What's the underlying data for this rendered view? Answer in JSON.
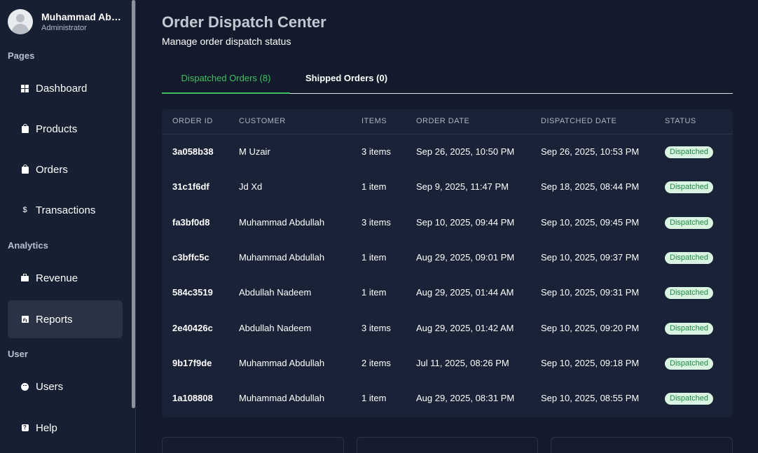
{
  "profile": {
    "name": "Muhammad Abdullah",
    "role": "Administrator"
  },
  "sidebar": {
    "sections": [
      "Pages",
      "Analytics",
      "User"
    ],
    "items": [
      {
        "label": "Dashboard",
        "icon": "dashboard-icon"
      },
      {
        "label": "Products",
        "icon": "shopping-bag-icon"
      },
      {
        "label": "Orders",
        "icon": "shopping-bag-icon"
      },
      {
        "label": "Transactions",
        "icon": "dollar-icon"
      },
      {
        "label": "Revenue",
        "icon": "briefcase-icon"
      },
      {
        "label": "Reports",
        "icon": "bar-chart-icon",
        "active": true
      },
      {
        "label": "Users",
        "icon": "face-icon"
      },
      {
        "label": "Help",
        "icon": "help-icon"
      }
    ]
  },
  "page": {
    "title": "Order Dispatch Center",
    "subtitle": "Manage order dispatch status"
  },
  "tabs": [
    {
      "label": "Dispatched Orders (8)",
      "active": true
    },
    {
      "label": "Shipped Orders (0)",
      "active": false
    }
  ],
  "table": {
    "columns": [
      "ORDER ID",
      "CUSTOMER",
      "ITEMS",
      "ORDER DATE",
      "DISPATCHED DATE",
      "STATUS"
    ],
    "rows": [
      [
        "3a058b38",
        "M Uzair",
        "3 items",
        "Sep 26, 2025, 10:50 PM",
        "Sep 26, 2025, 10:53 PM",
        "Dispatched"
      ],
      [
        "31c1f6df",
        "Jd Xd",
        "1 item",
        "Sep 9, 2025, 11:47 PM",
        "Sep 18, 2025, 08:44 PM",
        "Dispatched"
      ],
      [
        "fa3bf0d8",
        "Muhammad Abdullah",
        "3 items",
        "Sep 10, 2025, 09:44 PM",
        "Sep 10, 2025, 09:45 PM",
        "Dispatched"
      ],
      [
        "c3bffc5c",
        "Muhammad Abdullah",
        "1 item",
        "Aug 29, 2025, 09:01 PM",
        "Sep 10, 2025, 09:37 PM",
        "Dispatched"
      ],
      [
        "584c3519",
        "Abdullah Nadeem",
        "1 item",
        "Aug 29, 2025, 01:44 AM",
        "Sep 10, 2025, 09:31 PM",
        "Dispatched"
      ],
      [
        "2e40426c",
        "Abdullah Nadeem",
        "3 items",
        "Aug 29, 2025, 01:42 AM",
        "Sep 10, 2025, 09:20 PM",
        "Dispatched"
      ],
      [
        "9b17f9de",
        "Muhammad Abdullah",
        "2 items",
        "Jul 11, 2025, 08:26 PM",
        "Sep 10, 2025, 09:18 PM",
        "Dispatched"
      ],
      [
        "1a108808",
        "Muhammad Abdullah",
        "1 item",
        "Aug 29, 2025, 08:31 PM",
        "Sep 10, 2025, 08:55 PM",
        "Dispatched"
      ]
    ]
  },
  "colors": {
    "accent_green": "#3fbf62",
    "badge_bg": "#d9f5e1",
    "badge_text": "#1e8a45",
    "background": "#121a2b",
    "sidebar": "#172033"
  }
}
